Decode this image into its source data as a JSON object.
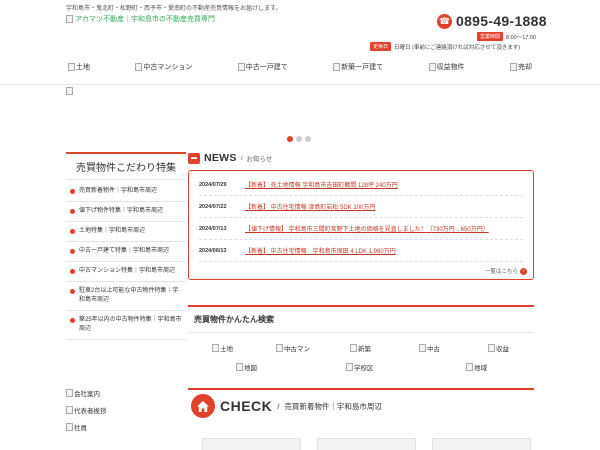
{
  "header": {
    "tagline": "宇和島市・鬼北町・松野町・西予市・愛南町の不動産売買情報をお届けします。",
    "logo_alt": "アカマツ不動産｜宇和島市の不動産売買専門",
    "phone": "0895-49-1888",
    "hours_badge": "営業時間",
    "hours": "8:00～17:00",
    "holiday_badge": "定休日",
    "holiday": "日曜日 (事前にご連絡頂ければ対応させて頂きます)"
  },
  "nav": [
    {
      "label": "土地"
    },
    {
      "label": "中古マンション"
    },
    {
      "label": "中古一戸建て"
    },
    {
      "label": "新築一戸建て"
    },
    {
      "label": "収益物件"
    },
    {
      "label": "売却"
    }
  ],
  "slider": {
    "dots": 3,
    "active": 0
  },
  "sidebar": {
    "title": "売買物件こだわり特集",
    "items": [
      {
        "label": "売買新着物件｜宇和島市周辺"
      },
      {
        "label": "値下げ物件特集｜宇和島市周辺"
      },
      {
        "label": "土地特集｜宇和島市周辺"
      },
      {
        "label": "中古一戸建て特集｜宇和島市周辺"
      },
      {
        "label": "中古マンション特集｜宇和島市周辺"
      },
      {
        "label": "駐車2台以上可能な中古物件特集｜宇和島市周辺"
      },
      {
        "label": "築25年以内の中古物件特集｜宇和島市周辺"
      }
    ],
    "links": [
      {
        "label": "会社案内"
      },
      {
        "label": "代表者挨拶"
      },
      {
        "label": "社員"
      }
    ]
  },
  "news": {
    "title": "NEWS",
    "subtitle": "お知らせ",
    "items": [
      {
        "date": "2024/07/29",
        "text": "【新着】 売土地情報 宇和島市吉田町鶴間 128坪 240万円"
      },
      {
        "date": "2024/07/22",
        "text": "【新着】 中古住宅情報 津島町岩松 5DK 100万円"
      },
      {
        "date": "2024/07/13",
        "text": "【値下げ情報】 宇和島市三間町宮野下土地の価格を見直しました！（730万円→650万円）"
      },
      {
        "date": "2024/06/13",
        "text": "【新着】 中古住宅情報　宇和島市保田 4 LDK 1,980万円"
      }
    ],
    "more": "一覧はこちら"
  },
  "search": {
    "title": "売買物件かんたん検索",
    "items_row1": [
      {
        "label": "土地"
      },
      {
        "label": "中古マン"
      },
      {
        "label": "新築"
      },
      {
        "label": "中古"
      },
      {
        "label": "収益"
      }
    ],
    "items_row2": [
      {
        "label": "地図"
      },
      {
        "label": "学校区"
      },
      {
        "label": "地域"
      }
    ]
  },
  "check": {
    "title": "CHECK",
    "subtitle": "売買新着物件｜宇和島市周辺"
  },
  "colors": {
    "accent": "#e0412d"
  }
}
